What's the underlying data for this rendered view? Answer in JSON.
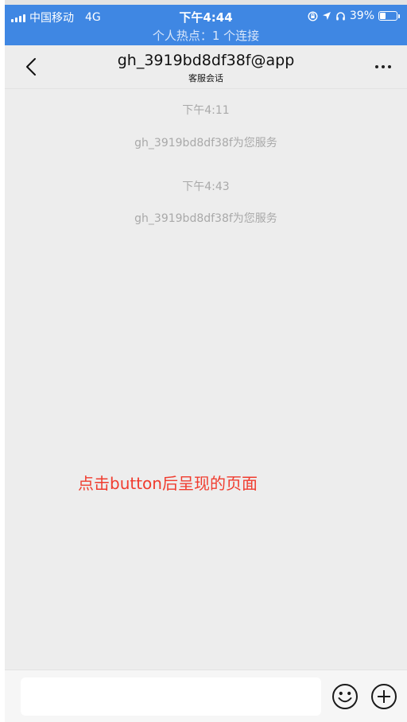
{
  "status_bar": {
    "carrier": "中国移动",
    "network": "4G",
    "time": "下午4:44",
    "battery": "39%",
    "battery_level": 0.39,
    "hotspot": "个人热点：1 个连接"
  },
  "nav": {
    "title": "gh_3919bd8df38f@app",
    "subtitle": "客服会话",
    "back_icon": "chevron-left-icon",
    "more_icon": "more-dots-icon"
  },
  "messages": [
    {
      "timestamp": "下午4:11",
      "text": "gh_3919bd8df38f为您服务"
    },
    {
      "timestamp": "下午4:43",
      "text": "gh_3919bd8df38f为您服务"
    }
  ],
  "annotation": "点击button后呈现的页面",
  "input_bar": {
    "placeholder": "",
    "emoji_icon": "emoji-icon",
    "plus_icon": "plus-circle-icon"
  },
  "colors": {
    "status_bar_bg": "#3f87e3",
    "chat_bg": "#ededed",
    "annotation": "#f03c2e"
  }
}
